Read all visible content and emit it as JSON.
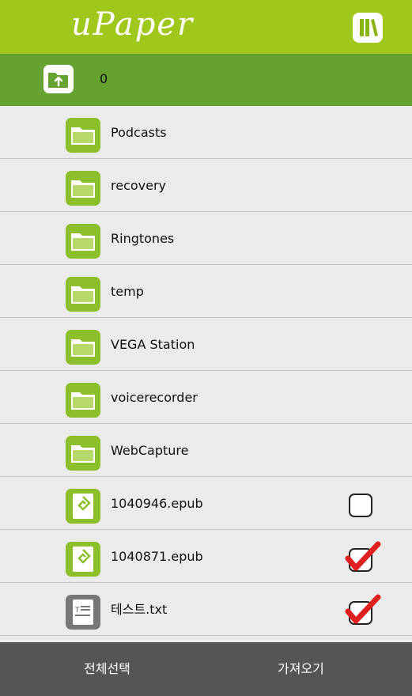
{
  "header": {
    "title": "uPaper",
    "library_icon": "library-books-icon",
    "colors": {
      "topbar": "#a0c71b",
      "pathbar": "#66a230",
      "bottombar": "#555555"
    }
  },
  "path": {
    "up_icon": "folder-up-icon",
    "current": "0"
  },
  "items": [
    {
      "type": "folder",
      "icon": "folder-icon",
      "name": "Podcasts"
    },
    {
      "type": "folder",
      "icon": "folder-icon",
      "name": "recovery"
    },
    {
      "type": "folder",
      "icon": "folder-icon",
      "name": "Ringtones"
    },
    {
      "type": "folder",
      "icon": "folder-icon",
      "name": "temp"
    },
    {
      "type": "folder",
      "icon": "folder-icon",
      "name": "VEGA Station"
    },
    {
      "type": "folder",
      "icon": "folder-icon",
      "name": "voicerecorder"
    },
    {
      "type": "folder",
      "icon": "folder-icon",
      "name": "WebCapture"
    },
    {
      "type": "epub",
      "icon": "epub-file-icon",
      "name": "1040946.epub",
      "checked": false
    },
    {
      "type": "epub",
      "icon": "epub-file-icon",
      "name": "1040871.epub",
      "checked": true
    },
    {
      "type": "txt",
      "icon": "text-file-icon",
      "name": "테스트.txt",
      "checked": true
    }
  ],
  "footer": {
    "select_all": "전체선택",
    "import": "가져오기"
  }
}
